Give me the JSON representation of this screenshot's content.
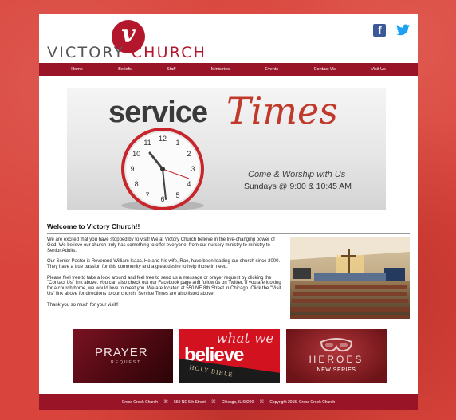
{
  "header": {
    "logo_letter": "v",
    "logo_word1": "VICTORY",
    "logo_word2": "CHURCH",
    "social": [
      {
        "name": "facebook",
        "letter": "f",
        "color": "#3b5998"
      },
      {
        "name": "twitter",
        "color": "#1da1f2"
      }
    ]
  },
  "nav": {
    "items": [
      "Home",
      "Beliefs",
      "Staff",
      "Ministries",
      "Events",
      "Contact Us",
      "Visit Us"
    ]
  },
  "banner": {
    "word1": "service",
    "word2": "Times",
    "line1": "Come & Worship with Us",
    "line2": "Sundays @ 9:00 & 10:45 AM",
    "clock_numbers": [
      "12",
      "1",
      "2",
      "3",
      "4",
      "5",
      "6",
      "7",
      "8",
      "9",
      "10",
      "11"
    ]
  },
  "welcome": {
    "title": "Welcome to Victory Church!!",
    "paragraphs": [
      "We are excited that you have stopped by to visit! We at Victory Church believe in the live-changing power of God. We believe our church truly has something to offer everyone, from our nursery ministry to ministry to Senior Adults.",
      "Our Senior Pastor is Reverend William Isaac. He and his wife, Rae, have been leading our church since 2000. They have a true passion for this community and a great desire to help those in need.",
      "Please feel free to take a look around and feel free to send us a message or prayer request by clicking the \"Contact Us\" link above. You can also check out our Facebook page and follow us on Twitter. If you are looking for a church home, we would love to meet you. We are located at 550 NE 8th Street in Chicago. Click the \"Visit Us\" link above for directions to our church. Service Times are also listed above.",
      "Thank you so much for your visit!!"
    ]
  },
  "tiles": {
    "prayer": {
      "title": "PRAYER",
      "sub": "REQUEST"
    },
    "believe": {
      "top": "what we",
      "main": "believe",
      "book": "HOLY BIBLE"
    },
    "heroes": {
      "title": "HEROES",
      "sub": "NEW SERIES"
    }
  },
  "footer": {
    "items": [
      "Cross Creek Church",
      "550 NE 5th Street",
      "Chicago, IL 60290",
      "Copyright 2015, Cross Creek Church"
    ],
    "separator": "⌘"
  },
  "colors": {
    "brand": "#9a1428",
    "logo": "#b3172c",
    "background": "#d9453c"
  }
}
